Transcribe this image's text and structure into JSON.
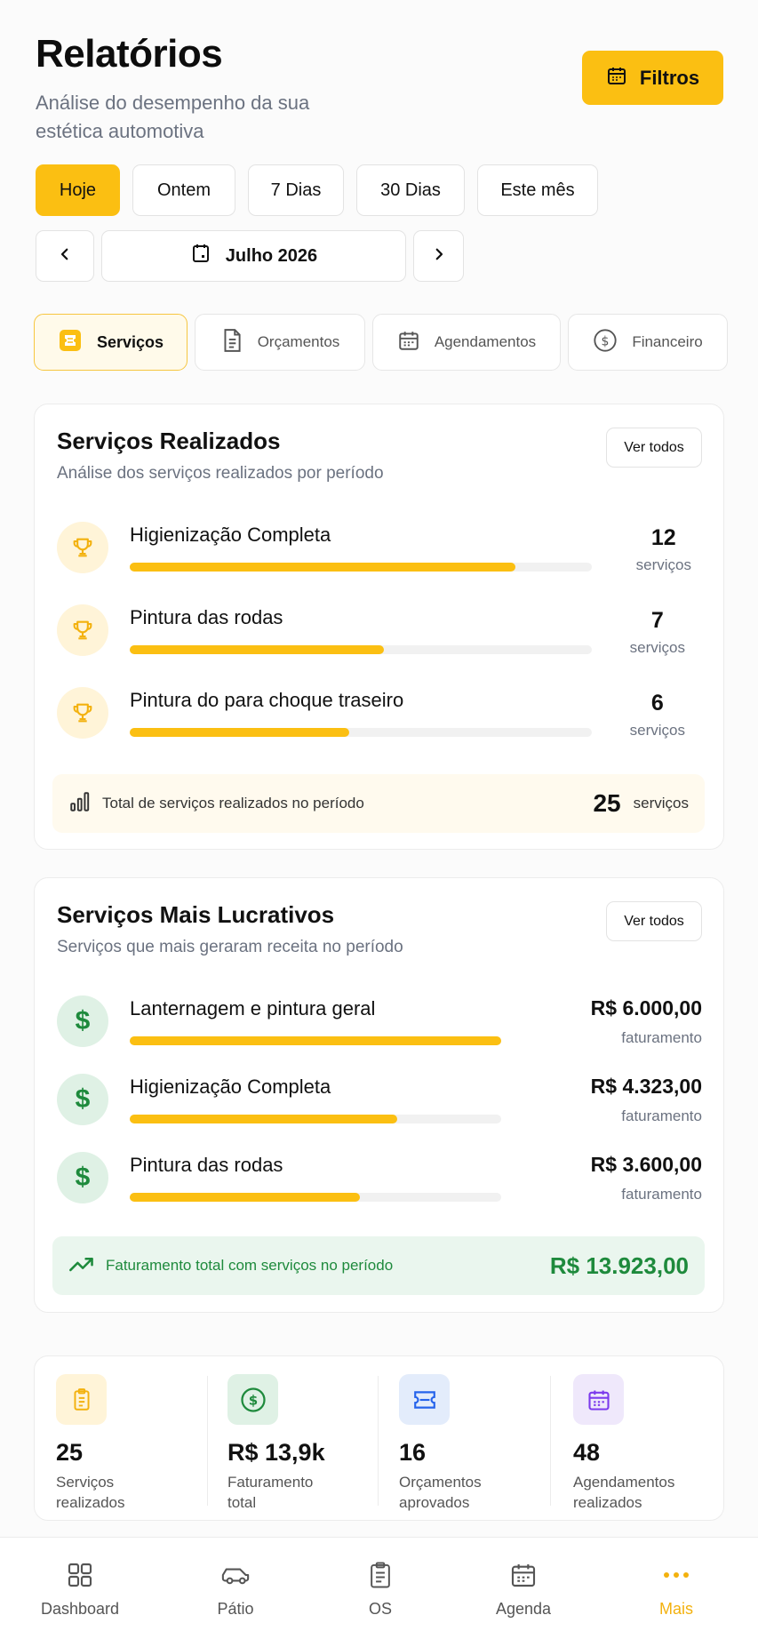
{
  "header": {
    "title": "Relatórios",
    "subtitle": "Análise do desempenho da sua estética automotiva",
    "filter_label": "Filtros"
  },
  "period_chips": [
    "Hoje",
    "Ontem",
    "7 Dias",
    "30 Dias",
    "Este mês"
  ],
  "month": {
    "label": "Julho 2026"
  },
  "tabs": [
    {
      "label": "Serviços",
      "icon": "ticket-icon",
      "active": true
    },
    {
      "label": "Orçamentos",
      "icon": "document-icon",
      "active": false
    },
    {
      "label": "Agendamentos",
      "icon": "calendar-icon",
      "active": false
    },
    {
      "label": "Financeiro",
      "icon": "dollar-circle-icon",
      "active": false
    }
  ],
  "services_done": {
    "title": "Serviços Realizados",
    "subtitle": "Análise dos serviços realizados por período",
    "see_all": "Ver todos",
    "items": [
      {
        "name": "Higienização Completa",
        "count": "12",
        "unit": "serviços",
        "progress": 0.835
      },
      {
        "name": "Pintura das rodas",
        "count": "7",
        "unit": "serviços",
        "progress": 0.55
      },
      {
        "name": "Pintura do para choque traseiro",
        "count": "6",
        "unit": "serviços",
        "progress": 0.475
      }
    ],
    "total_label": "Total de serviços realizados no período",
    "total_value": "25",
    "total_unit": "serviços"
  },
  "profitable": {
    "title": "Serviços Mais Lucrativos",
    "subtitle": "Serviços que mais geraram receita no período",
    "see_all": "Ver todos",
    "items": [
      {
        "name": "Lanternagem e pintura geral",
        "value": "R$ 6.000,00",
        "unit": "faturamento",
        "progress": 1.0
      },
      {
        "name": "Higienização Completa",
        "value": "R$ 4.323,00",
        "unit": "faturamento",
        "progress": 0.72
      },
      {
        "name": "Pintura das rodas",
        "value": "R$ 3.600,00",
        "unit": "faturamento",
        "progress": 0.62
      }
    ],
    "total_label": "Faturamento total com serviços no período",
    "total_value": "R$ 13.923,00"
  },
  "stats": [
    {
      "value": "25",
      "label": "Serviços realizados",
      "icon": "clipboard-icon",
      "color": "#f3b10e",
      "bg": "#fff4d8"
    },
    {
      "value": "R$ 13,9k",
      "label": "Faturamento total",
      "icon": "dollar-circle-icon",
      "color": "#1e8a3c",
      "bg": "#dff1e5"
    },
    {
      "value": "16",
      "label": "Orçamentos aprovados",
      "icon": "ticket-icon",
      "color": "#2563eb",
      "bg": "#e3ecfb"
    },
    {
      "value": "48",
      "label": "Agendamentos realizados",
      "icon": "calendar-icon",
      "color": "#7c3aed",
      "bg": "#efe8fb"
    }
  ],
  "bottom_nav": [
    {
      "label": "Dashboard",
      "icon": "grid-icon",
      "active": false
    },
    {
      "label": "Pátio",
      "icon": "car-icon",
      "active": false
    },
    {
      "label": "OS",
      "icon": "clipboard-icon",
      "active": false
    },
    {
      "label": "Agenda",
      "icon": "calendar-icon",
      "active": false
    },
    {
      "label": "Mais",
      "icon": "more-dots-icon",
      "active": true
    }
  ],
  "colors": {
    "accent": "#fbbf12",
    "green": "#1e8a3c",
    "muted": "#6b7280"
  }
}
